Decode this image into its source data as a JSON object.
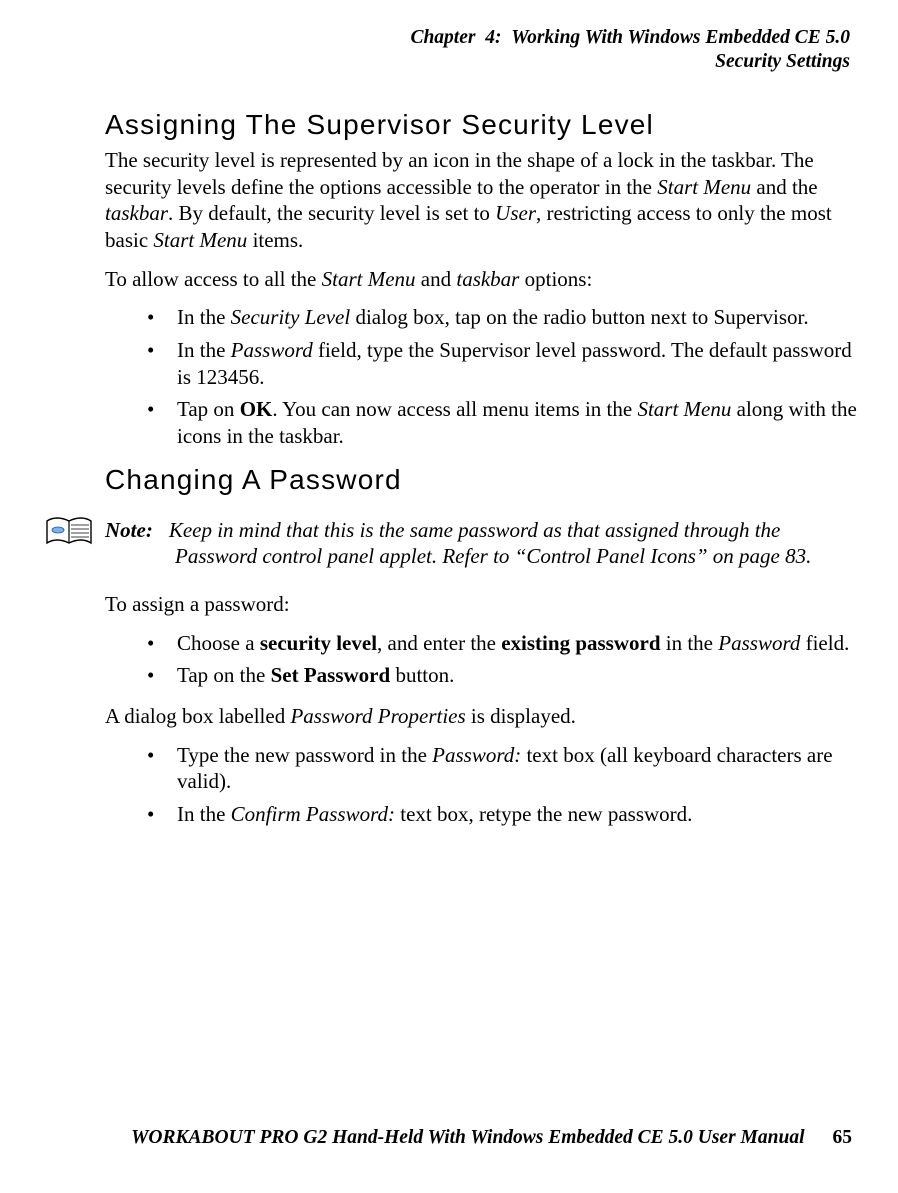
{
  "header": {
    "line1": "Chapter  4:  Working With Windows Embedded CE 5.0",
    "line2": "Security Settings"
  },
  "section1": {
    "title": "Assigning The Supervisor Security Level",
    "p1a": "The security level is represented by an icon in the shape of a lock in the taskbar. The security levels define the options accessible to the operator in the ",
    "p1b": "Start Menu",
    "p1c": " and the ",
    "p1d": "taskbar",
    "p1e": ". By default, the security level is set to ",
    "p1f": "User",
    "p1g": ", restricting access to only the most basic ",
    "p1h": "Start Menu",
    "p1i": " items.",
    "p2a": "To allow access to all the ",
    "p2b": "Start Menu",
    "p2c": " and ",
    "p2d": "taskbar",
    "p2e": " options:",
    "b1a": "In the ",
    "b1b": "Security Level",
    "b1c": " dialog box, tap on the radio button next to Supervisor.",
    "b2a": "In the ",
    "b2b": "Password",
    "b2c": " field, type the Supervisor level password. The default password is 123456.",
    "b3a": "Tap on ",
    "b3b": "OK",
    "b3c": ". You can now access all menu items in the ",
    "b3d": "Start Menu",
    "b3e": " along with the icons in the taskbar."
  },
  "section2": {
    "title": "Changing A Password",
    "note_label": "Note:",
    "note_body": "Keep in mind that this is the same password as that assigned through the Password control panel applet. Refer to “Control Panel Icons” on page 83.",
    "p1": "To assign a password:",
    "b1a": "Choose a ",
    "b1b": "security level",
    "b1c": ", and enter the ",
    "b1d": "existing password",
    "b1e": " in the ",
    "b1f": "Password",
    "b1g": " field.",
    "b2a": "Tap on the ",
    "b2b": "Set Password",
    "b2c": " button.",
    "p2a": "A dialog box labelled ",
    "p2b": "Password Properties",
    "p2c": " is displayed.",
    "b3a": "Type the new password in the ",
    "b3b": "Password:",
    "b3c": " text box (all keyboard characters are valid).",
    "b4a": "In the ",
    "b4b": "Confirm Password:",
    "b4c": " text box, retype the new password."
  },
  "footer": {
    "title": "WORKABOUT PRO G2 Hand-Held With Windows Embedded CE 5.0 User Manual",
    "page": "65"
  }
}
